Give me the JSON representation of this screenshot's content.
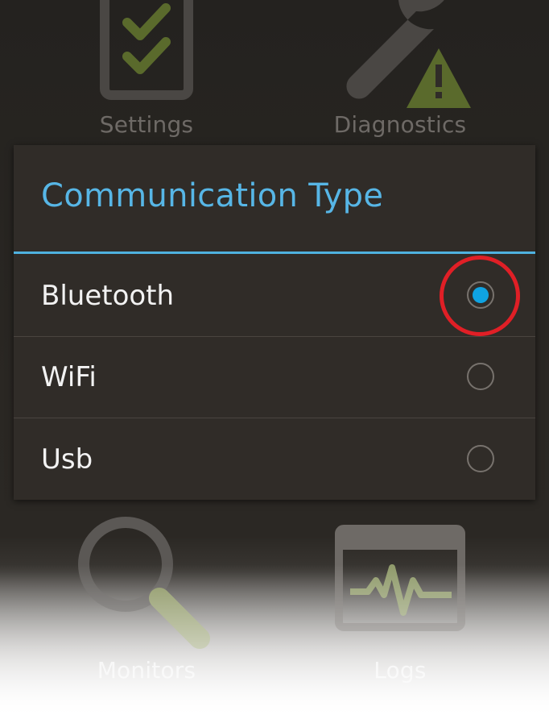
{
  "home": {
    "tiles": [
      {
        "label": "Settings",
        "icon": "checklist-icon"
      },
      {
        "label": "Diagnostics",
        "icon": "wrench-warning-icon"
      },
      {
        "label": "Monitors",
        "icon": "magnifier-icon"
      },
      {
        "label": "Logs",
        "icon": "heartbeat-monitor-icon"
      }
    ]
  },
  "dialog": {
    "title": "Communication Type",
    "options": [
      {
        "label": "Bluetooth",
        "selected": true
      },
      {
        "label": "WiFi",
        "selected": false
      },
      {
        "label": "Usb",
        "selected": false
      }
    ],
    "colors": {
      "accent": "#57b6e6",
      "radio_selected": "#0fa3e2",
      "highlight_ring": "#e01f26"
    }
  }
}
